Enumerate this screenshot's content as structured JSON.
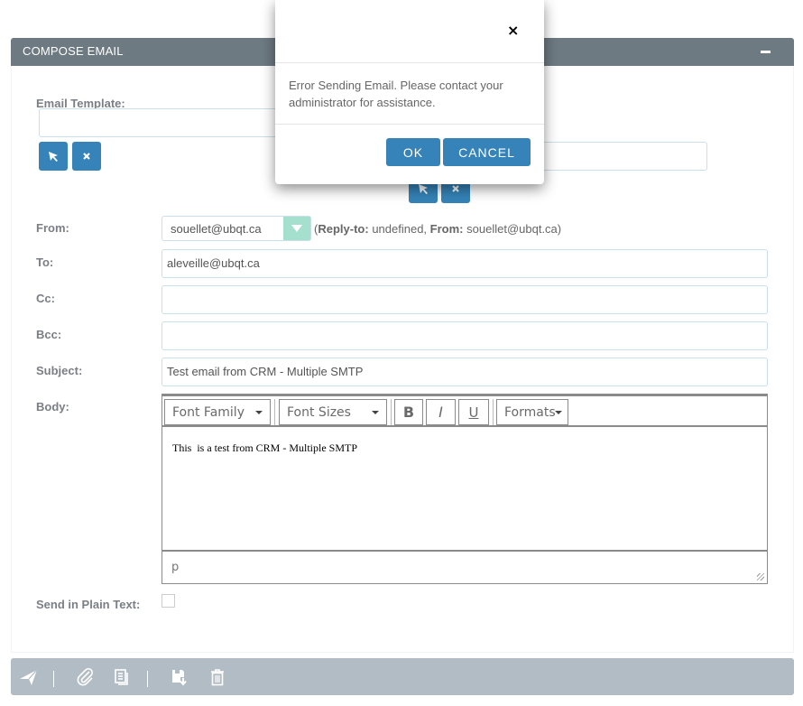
{
  "panel": {
    "title": "COMPOSE EMAIL"
  },
  "form": {
    "email_template_label": "Email Template:",
    "email_template_value": "",
    "related_value": "",
    "from_label": "From:",
    "from_value": "souellet@ubqt.ca",
    "reply_to_label": "Reply-to:",
    "reply_to_value": "undefined,",
    "reply_from_label": "From:",
    "reply_from_value": "souellet@ubqt.ca)",
    "reply_open": "(",
    "to_label": "To:",
    "to_value": "aleveille@ubqt.ca",
    "cc_label": "Cc:",
    "cc_value": "",
    "bcc_label": "Bcc:",
    "bcc_value": "",
    "subject_label": "Subject:",
    "subject_value": "Test email from CRM - Multiple SMTP",
    "body_label": "Body:",
    "plain_text_label": "Send in Plain Text:",
    "plain_text_checked": false
  },
  "editor": {
    "font_family": "Font Family",
    "font_sizes": "Font Sizes",
    "bold": "B",
    "italic": "I",
    "underline": "U",
    "formats": "Formats",
    "content": "This  is a test from CRM - Multiple SMTP",
    "path": "p"
  },
  "modal": {
    "close": "×",
    "message": "Error Sending Email. Please contact your administrator for assistance.",
    "ok": "OK",
    "cancel": "CANCEL"
  },
  "footer": {
    "icons": [
      "send-icon",
      "attachment-icon",
      "document-icon",
      "save-draft-icon",
      "trash-icon"
    ]
  }
}
